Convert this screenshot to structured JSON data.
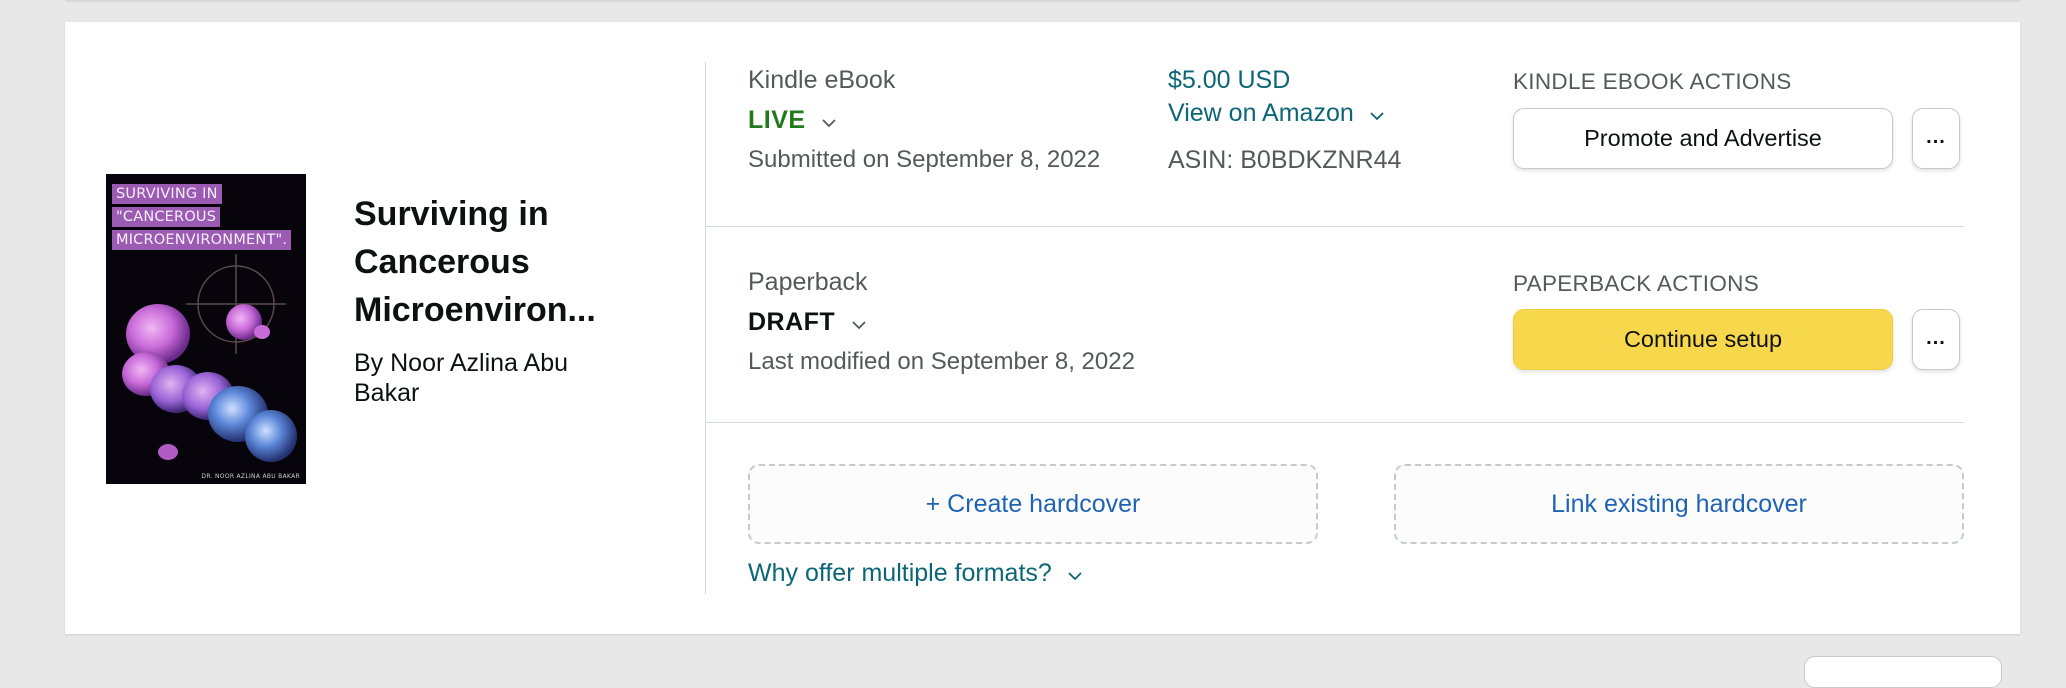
{
  "book": {
    "title": "Surviving in Cancerous Microenviron...",
    "author": "By Noor Azlina Abu Bakar",
    "cover": {
      "lines": [
        "SURVIVING IN",
        "\"CANCEROUS",
        "MICROENVIRONMENT\"."
      ],
      "author_line": "DR. NOOR AZLINA ABU BAKAR",
      "colors": {
        "background": "#07040c",
        "tag": "#9b5bb2",
        "cells_purple": "#c86ad8",
        "cells_blue": "#5b86d8"
      }
    }
  },
  "kindle": {
    "format_label": "Kindle eBook",
    "status": "LIVE",
    "submitted": "Submitted on September 8, 2022",
    "price": "$5.00 USD",
    "view_link": "View on Amazon",
    "asin": "ASIN: B0BDKZNR44",
    "actions_label": "KINDLE EBOOK ACTIONS",
    "primary_button": "Promote and Advertise",
    "more_button": "..."
  },
  "paperback": {
    "format_label": "Paperback",
    "status": "DRAFT",
    "modified": "Last modified on September 8, 2022",
    "actions_label": "PAPERBACK ACTIONS",
    "primary_button": "Continue setup",
    "more_button": "..."
  },
  "hardcover": {
    "create_button": "+ Create hardcover",
    "link_button": "Link existing hardcover",
    "why_link": "Why offer multiple formats?"
  },
  "colors": {
    "live_green": "#237a1c",
    "link_teal": "#0d6677",
    "link_blue": "#1f63b3",
    "button_yellow": "#f7d84c"
  },
  "icons": [
    "chevron-down-icon",
    "more-options-icon"
  ]
}
